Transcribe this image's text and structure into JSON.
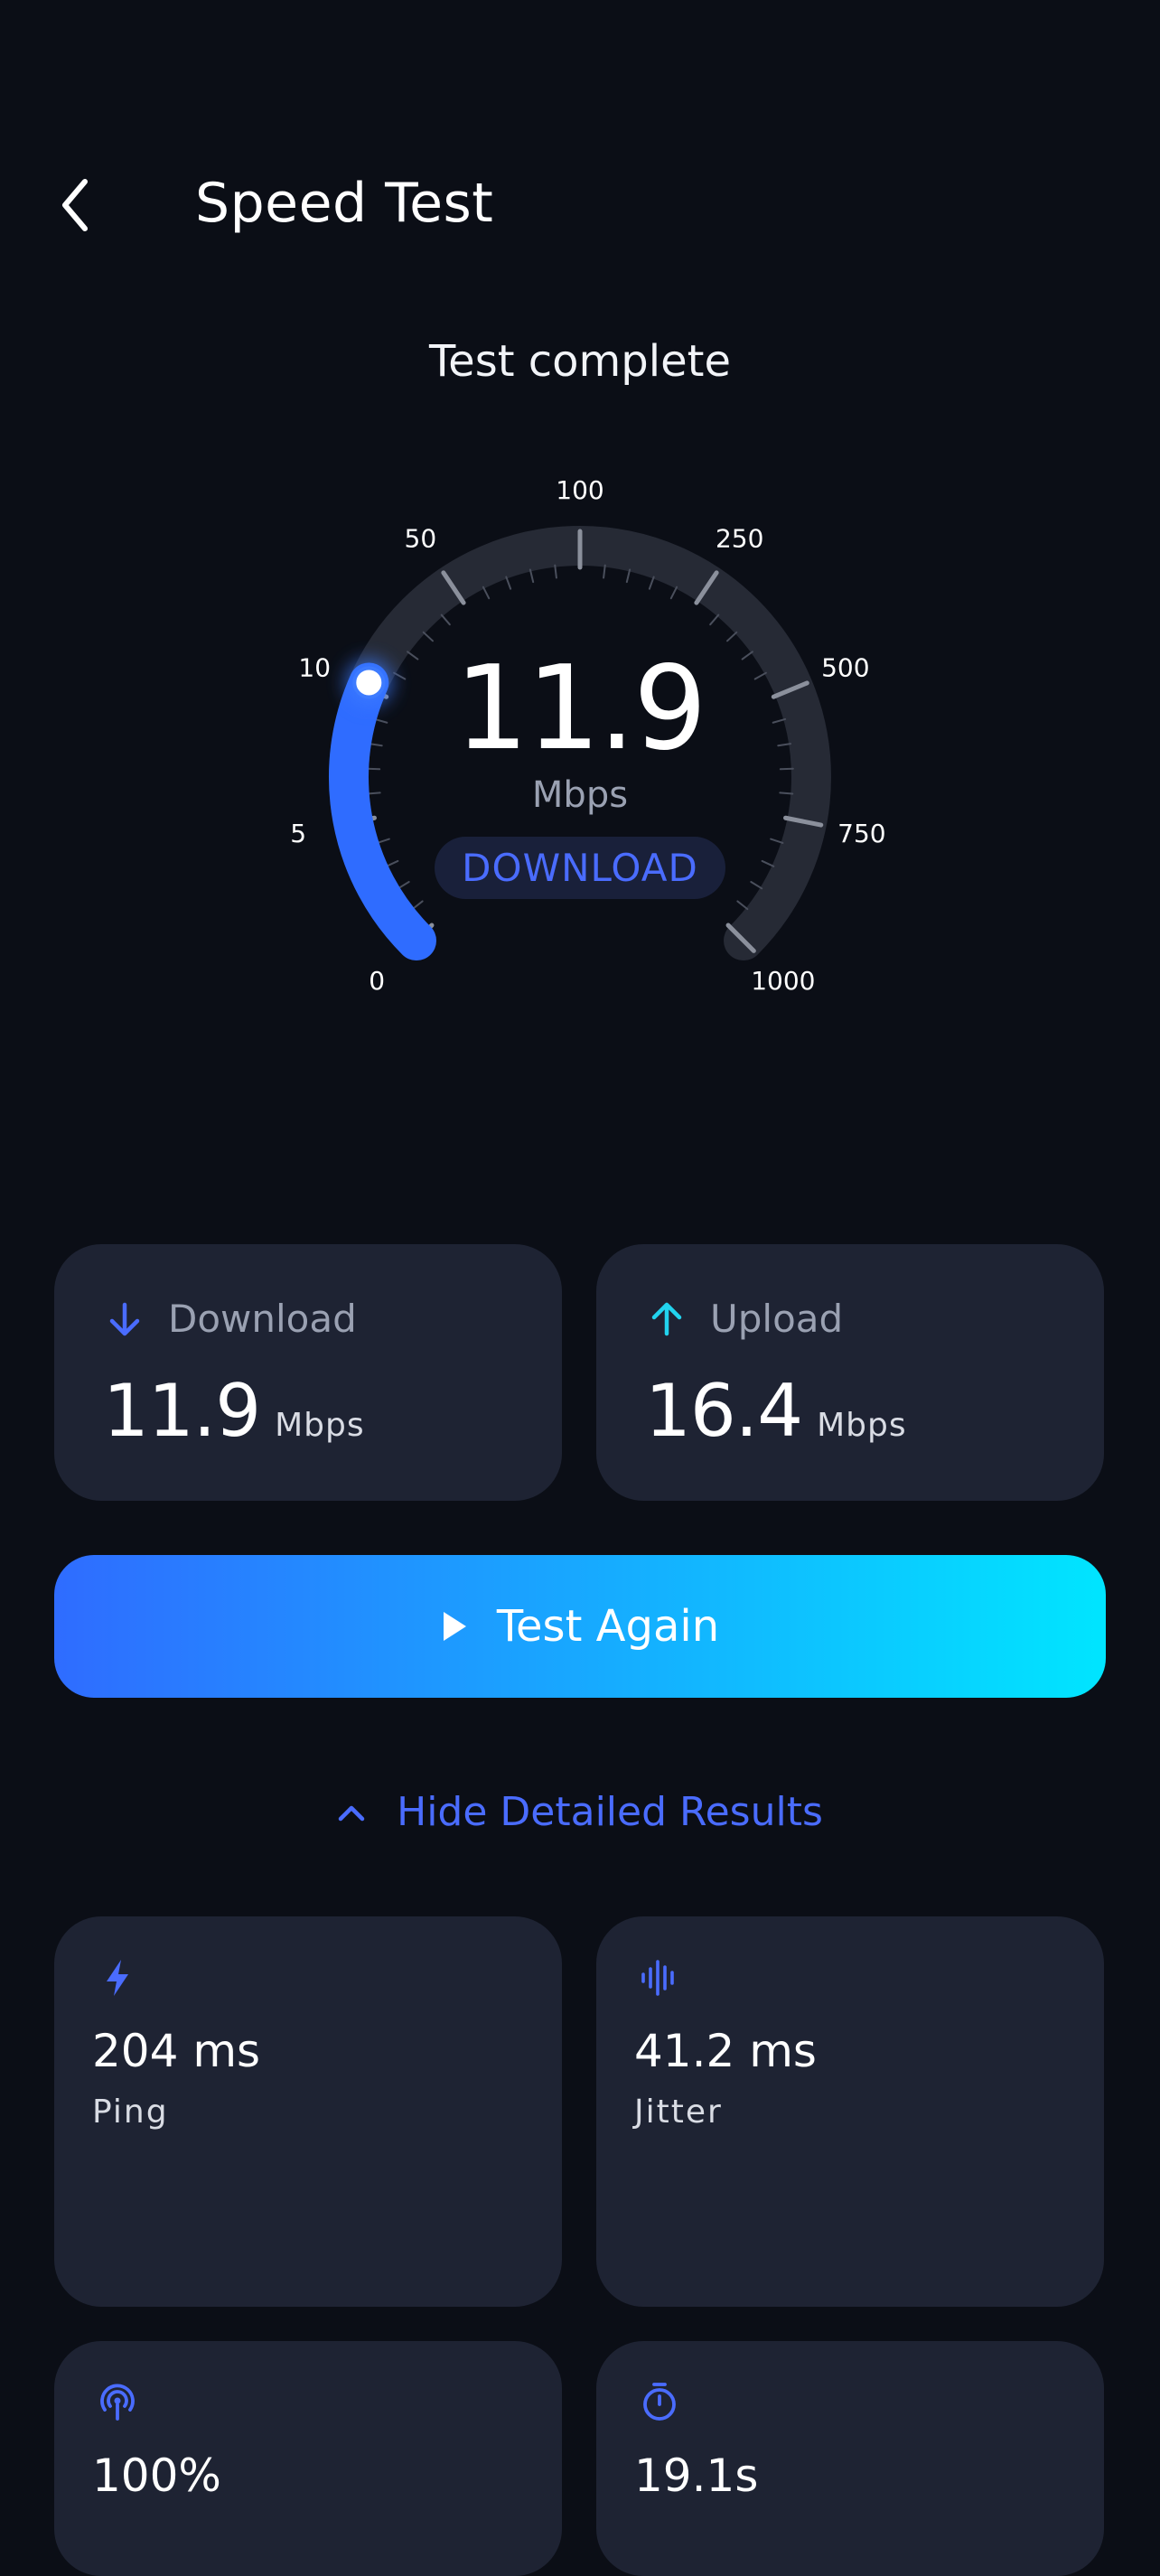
{
  "header": {
    "title": "Speed Test",
    "back_icon": "chevron-left-icon"
  },
  "status": "Test complete",
  "gauge": {
    "value": "11.9",
    "value_number": 11.9,
    "unit": "Mbps",
    "mode": "DOWNLOAD",
    "scale_labels": [
      "0",
      "5",
      "10",
      "50",
      "100",
      "250",
      "500",
      "750",
      "1000"
    ],
    "fill_color": "#2f6cff",
    "track_color": "#262a35"
  },
  "summary": {
    "download": {
      "label": "Download",
      "value": "11.9",
      "unit": "Mbps",
      "icon": "arrow-down-icon",
      "color": "#4a6cff"
    },
    "upload": {
      "label": "Upload",
      "value": "16.4",
      "unit": "Mbps",
      "icon": "arrow-up-icon",
      "color": "#22d3ee"
    }
  },
  "actions": {
    "test_again": "Test Again",
    "test_again_icon": "play-icon",
    "toggle_details": "Hide Detailed Results",
    "toggle_icon": "chevron-up-icon"
  },
  "details": [
    {
      "value": "204 ms",
      "label": "Ping",
      "icon": "lightning-icon"
    },
    {
      "value": "41.2 ms",
      "label": "Jitter",
      "icon": "waveform-icon"
    },
    {
      "value": "100%",
      "label": "",
      "icon": "signal-icon"
    },
    {
      "value": "19.1s",
      "label": "",
      "icon": "timer-icon"
    }
  ],
  "colors": {
    "background": "#0b0e16",
    "card": "#1e2333",
    "accent": "#4a6cff",
    "gradient_start": "#2f6cff",
    "gradient_end": "#00e5ff"
  }
}
